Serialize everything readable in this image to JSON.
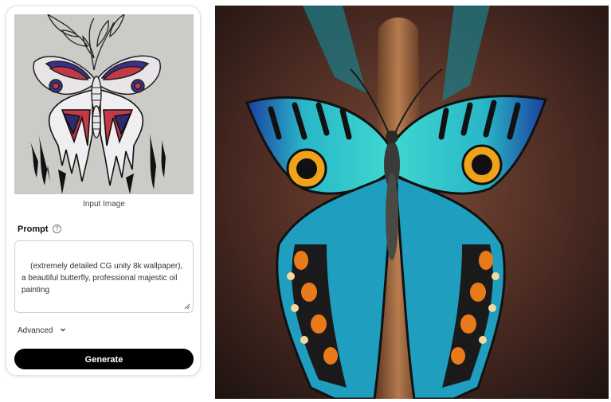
{
  "input_panel": {
    "image_caption": "Input Image",
    "image_icon": "butterfly-sketch-image",
    "prompt_label": "Prompt",
    "help_icon": "question-icon",
    "prompt_value": "(extremely detailed CG unity 8k wallpaper), a beautiful butterfly, professional majestic oil painting",
    "advanced_label": "Advanced",
    "generate_label": "Generate"
  },
  "output_panel": {
    "image_icon": "generated-butterfly-image"
  },
  "colors": {
    "button_bg": "#000000",
    "button_text": "#ffffff",
    "panel_border": "#e2e2e2"
  }
}
